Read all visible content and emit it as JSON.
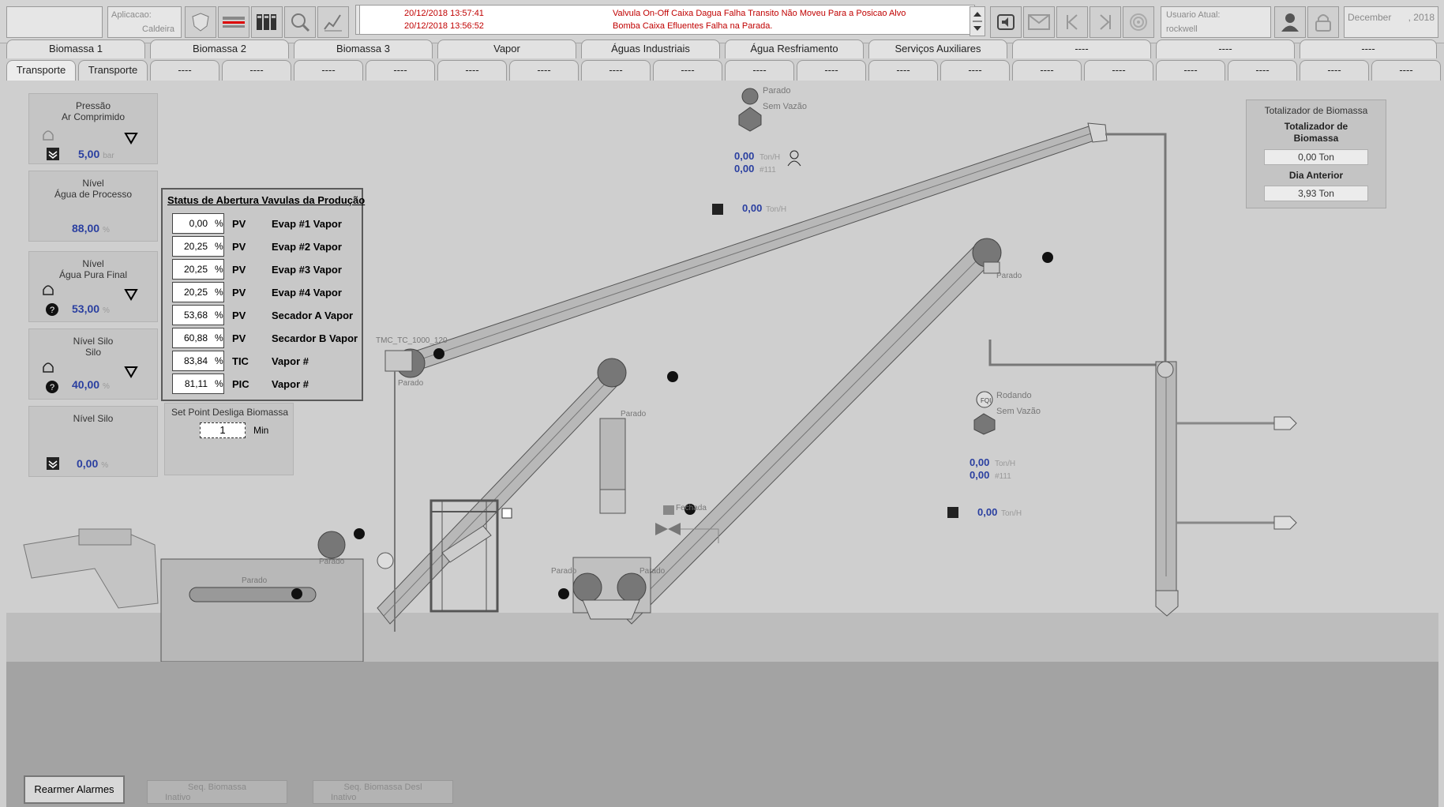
{
  "topbar": {
    "app_label": "Aplicacao:",
    "app_value": "Caldeira",
    "user_label": "Usuario Atual:",
    "user_value": "rockwell",
    "date_month": "December",
    "date_year": ", 2018"
  },
  "alarms": [
    {
      "time": "20/12/2018 13:57:41",
      "message": "Valvula On-Off Caixa Dagua Falha Transito Não Moveu Para a Posicao Alvo"
    },
    {
      "time": "20/12/2018 13:56:52",
      "message": "Bomba Caixa Efluentes Falha na Parada."
    }
  ],
  "tabs_row1": [
    "Biomassa 1",
    "Biomassa 2",
    "Biomassa 3",
    "Vapor",
    "Águas Industriais",
    "Água Resfriamento",
    "Serviços Auxiliares",
    "----",
    "----",
    "----"
  ],
  "tabs_row2": [
    "Transporte",
    "Transporte",
    "----",
    "----",
    "----",
    "----",
    "----",
    "----",
    "----",
    "----",
    "----",
    "----",
    "----",
    "----",
    "----",
    "----",
    "----",
    "----",
    "----",
    "----"
  ],
  "side_panels": [
    {
      "label1": "Pressão",
      "label2": "Ar Comprimido",
      "value": "5,00",
      "unit": "bar"
    },
    {
      "label1": "Nível",
      "label2": "Água de Processo",
      "value": "88,00",
      "unit": "%"
    },
    {
      "label1": "Nível",
      "label2": "Água Pura Final",
      "value": "53,00",
      "unit": "%"
    },
    {
      "label1": "Nível Silo",
      "label2": "Silo",
      "value": "40,00",
      "unit": "%"
    },
    {
      "label1": "Nível Silo",
      "label2": "",
      "value": "0,00",
      "unit": "%"
    }
  ],
  "valves_status": {
    "title": "Status de Abertura Vavulas da Produção",
    "rows": [
      {
        "value": "0,00",
        "pct": "%",
        "type": "PV",
        "name": "Evap #1 Vapor"
      },
      {
        "value": "20,25",
        "pct": "%",
        "type": "PV",
        "name": "Evap #2 Vapor"
      },
      {
        "value": "20,25",
        "pct": "%",
        "type": "PV",
        "name": "Evap #3 Vapor"
      },
      {
        "value": "20,25",
        "pct": "%",
        "type": "PV",
        "name": "Evap #4 Vapor"
      },
      {
        "value": "53,68",
        "pct": "%",
        "type": "PV",
        "name": "Secador A Vapor"
      },
      {
        "value": "60,88",
        "pct": "%",
        "type": "PV",
        "name": "Secardor B Vapor"
      },
      {
        "value": "83,84",
        "pct": "%",
        "type": "TIC",
        "name": "Vapor #"
      },
      {
        "value": "81,11",
        "pct": "%",
        "type": "PIC",
        "name": "Vapor #"
      }
    ]
  },
  "setpoint": {
    "label": "Set Point Desliga Biomassa",
    "value": "1",
    "unit": "Min"
  },
  "totalizer": {
    "header": "Totalizador de Biomassa",
    "title": "Totalizador de Biomassa",
    "value": "0,00 Ton",
    "prev_label": "Dia Anterior",
    "prev_value": "3,93 Ton"
  },
  "process": {
    "top_status1": "Parado",
    "top_status2": "Sem Vazão",
    "top_flow": "0,00",
    "top_flow_unit": "Ton/H",
    "top_count": "0,00",
    "top_count_unit": "#111",
    "top_flow2": "0,00",
    "top_flow2_unit": "Ton/H",
    "conv_tag": "TMC_TC_1000_120",
    "status_parado": "Parado",
    "status_fechada": "Fechada",
    "right_status1": "Rodando",
    "right_status2": "Sem Vazão",
    "fqi": "FQI",
    "right_flow": "0,00",
    "right_flow_unit": "Ton/H",
    "right_count": "0,00",
    "right_count_unit": "#111",
    "right_flow2": "0,00",
    "right_flow2_unit": "Ton/H"
  },
  "bottom": {
    "rearm": "Rearmer Alarmes",
    "seq1": "Seq. Biomassa",
    "seq1_state": "Inativo",
    "seq2": "Seq. Biomassa Desl",
    "seq2_state": "Inativo"
  },
  "colors": {
    "value_blue": "#2a3fa0",
    "alarm_red": "#c00000"
  }
}
